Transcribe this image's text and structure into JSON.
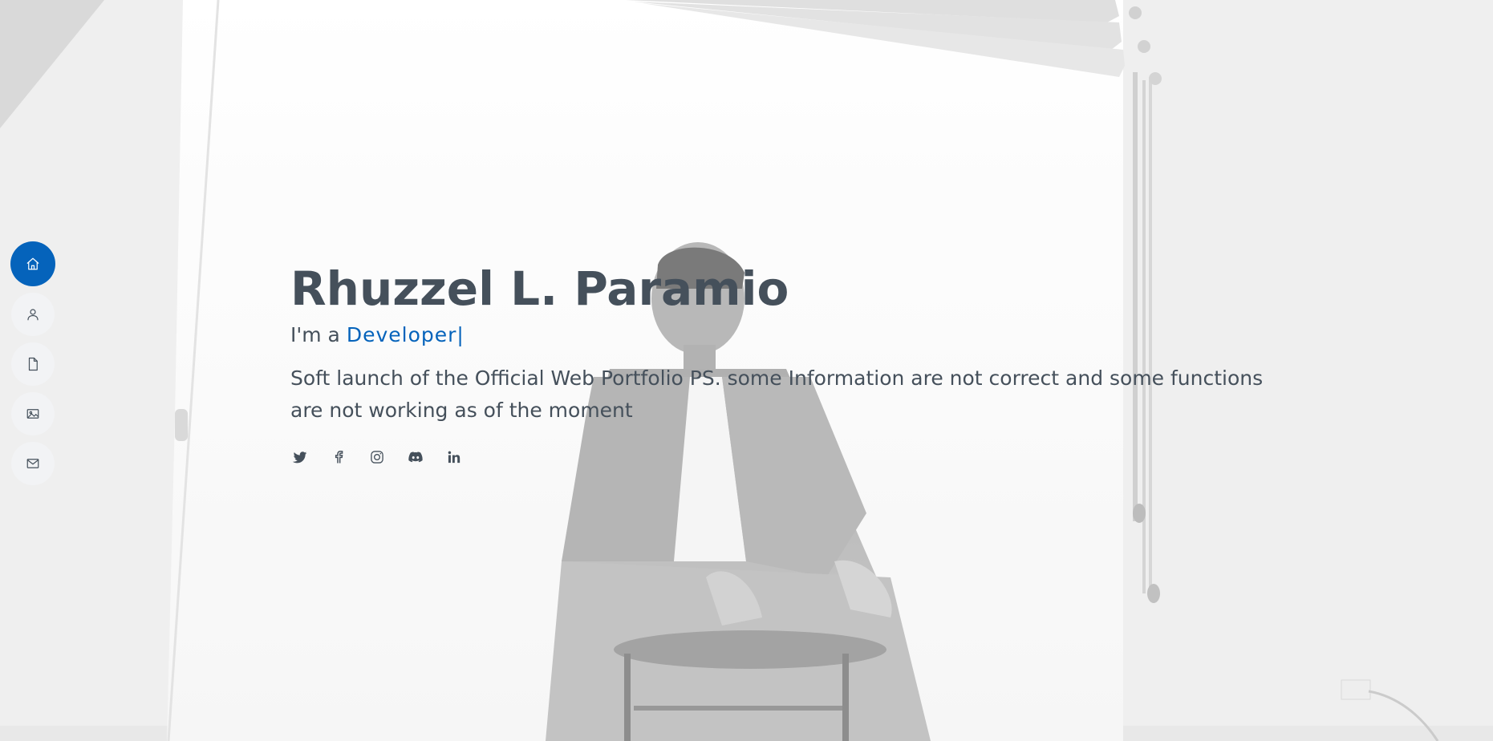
{
  "nav": {
    "items": [
      {
        "label": "Home",
        "icon": "house-icon",
        "active": true
      },
      {
        "label": "About",
        "icon": "person-icon",
        "active": false
      },
      {
        "label": "Resume",
        "icon": "file-icon",
        "active": false
      },
      {
        "label": "Portfolio",
        "icon": "image-icon",
        "active": false
      },
      {
        "label": "Contact",
        "icon": "envelope-icon",
        "active": false
      }
    ]
  },
  "hero": {
    "name": "Rhuzzel L. Paramio",
    "role_prefix": "I'm a ",
    "role_typed": "Developer",
    "cursor": "|",
    "description": "Soft launch of the Official Web Portfolio PS. some Information are not correct and some functions are not working as of the moment"
  },
  "social": [
    {
      "icon": "twitter-icon"
    },
    {
      "icon": "facebook-icon"
    },
    {
      "icon": "instagram-icon"
    },
    {
      "icon": "discord-icon"
    },
    {
      "icon": "linkedin-icon"
    }
  ],
  "colors": {
    "accent": "#0563bb",
    "text": "#45505b",
    "nav_bg": "#f2f3f5"
  }
}
